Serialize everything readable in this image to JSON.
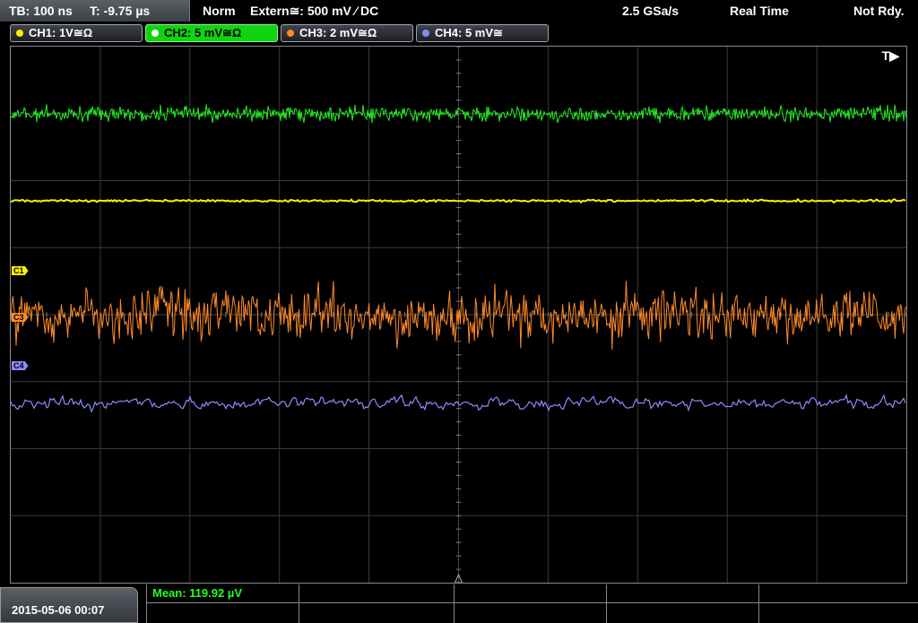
{
  "status_bar": {
    "timebase": "TB: 100 ns",
    "trigger_time": "T: -9.75 µs",
    "trigger_mode": "Norm",
    "trigger_source": "Extern≅: 500 mV ⁄ DC",
    "sample_rate": "2.5 GSa/s",
    "acquisition_mode": "Real Time",
    "state": "Not Rdy."
  },
  "channels": [
    {
      "label": "CH1: 1V≅Ω",
      "color": "#ffee00",
      "active": false
    },
    {
      "label": "CH2: 5 mV≅Ω",
      "color": "#22ee22",
      "active": true
    },
    {
      "label": "CH3: 2 mV≅Ω",
      "color": "#ff8a28",
      "active": false
    },
    {
      "label": "CH4: 5 mV≅",
      "color": "#8a8aff",
      "active": false
    }
  ],
  "markers": {
    "c1": "C1",
    "c3": "C3",
    "c4": "C4",
    "trigger": "T▶"
  },
  "traces": {
    "ch1_color": "#ffee00",
    "ch2_color": "#22ee22",
    "ch3_color": "#ff8a28",
    "ch4_color": "#8a8aff"
  },
  "footer": {
    "datetime": "2015-05-06 00:07",
    "measurement": "Mean: 119.92 µV"
  }
}
